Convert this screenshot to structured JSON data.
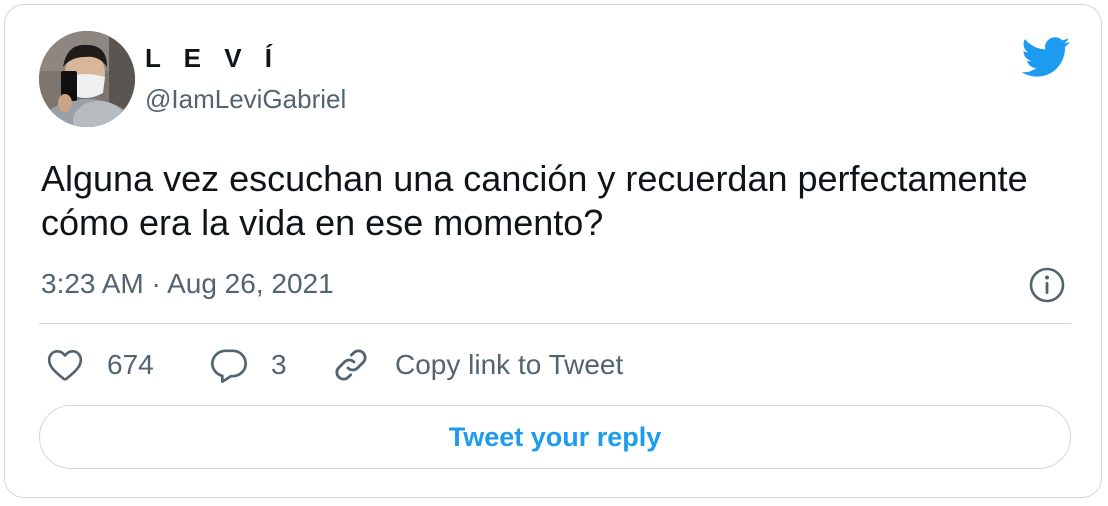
{
  "tweet": {
    "author": {
      "display_name": "L E V Í",
      "handle": "@IamLeviGabriel"
    },
    "text": "Alguna vez escuchan una canción y recuerdan perfectamente cómo era la vida en ese momento?",
    "timestamp": "3:23 AM · Aug 26, 2021",
    "actions": {
      "like_count": "674",
      "reply_count": "3",
      "copy_link_label": "Copy link to Tweet"
    },
    "reply_button_label": "Tweet your reply"
  },
  "icons": {
    "brand": "twitter-bird-icon",
    "info": "info-icon",
    "like": "heart-icon",
    "reply": "speech-bubble-icon",
    "copy": "link-icon"
  },
  "colors": {
    "accent": "#1d9bf0",
    "text_primary": "#0f1419",
    "text_secondary": "#536471",
    "border": "#cfd9de"
  }
}
